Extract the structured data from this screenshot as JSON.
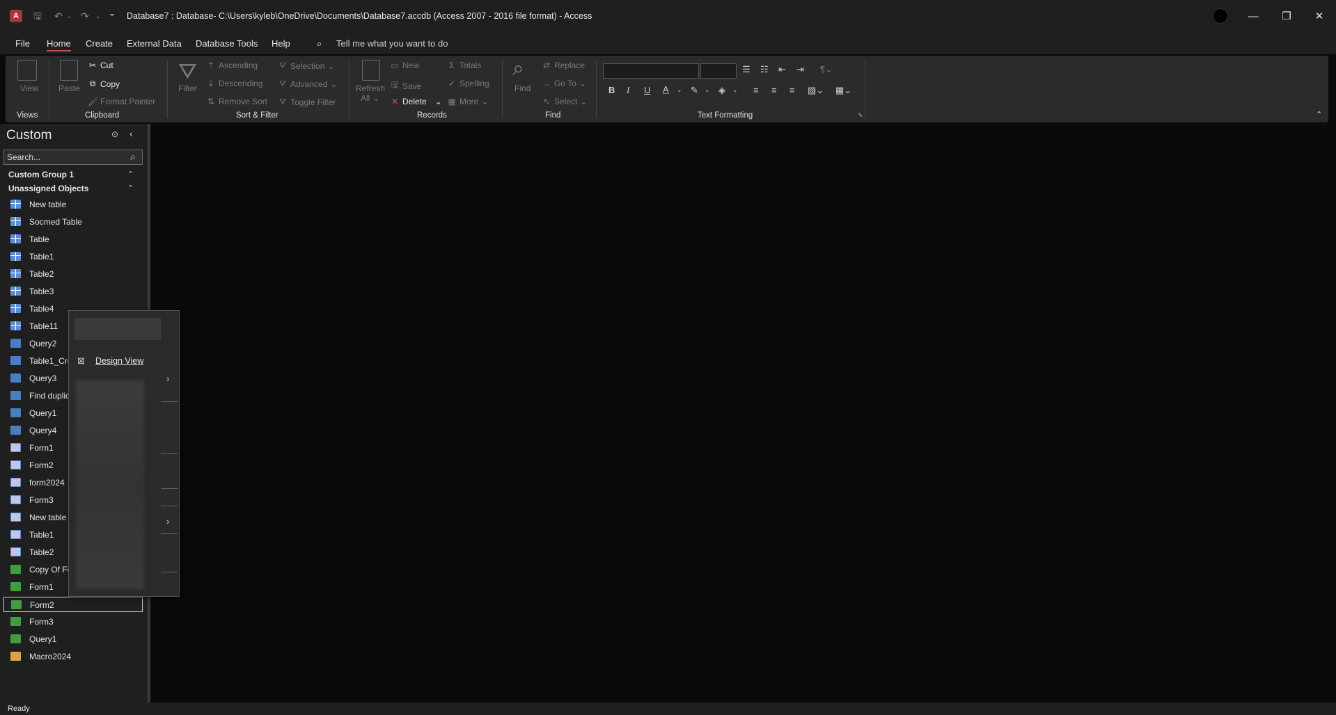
{
  "titlebar": {
    "app_icon": "A",
    "title": "Database7 : Database- C:\\Users\\kyleb\\OneDrive\\Documents\\Database7.accdb (Access 2007 - 2016 file format)  -  Access",
    "minimize": "—",
    "restore": "❐",
    "close": "✕"
  },
  "menu": {
    "tabs": [
      "File",
      "Home",
      "Create",
      "External Data",
      "Database Tools",
      "Help"
    ],
    "tell_me": "Tell me what you want to do"
  },
  "ribbon": {
    "views": {
      "view": "View",
      "label": "Views"
    },
    "clipboard": {
      "paste": "Paste",
      "cut": "Cut",
      "copy": "Copy",
      "format_painter": "Format Painter",
      "label": "Clipboard"
    },
    "sort_filter": {
      "filter": "Filter",
      "ascending": "Ascending",
      "descending": "Descending",
      "remove_sort": "Remove Sort",
      "selection": "Selection",
      "advanced": "Advanced",
      "toggle_filter": "Toggle Filter",
      "label": "Sort & Filter"
    },
    "records": {
      "refresh": "Refresh",
      "refresh_all": "All",
      "new": "New",
      "save": "Save",
      "delete": "Delete",
      "totals": "Totals",
      "spelling": "Spelling",
      "more": "More",
      "label": "Records"
    },
    "find": {
      "find": "Find",
      "replace": "Replace",
      "go_to": "Go To",
      "select": "Select",
      "label": "Find"
    },
    "text_formatting": {
      "bold": "B",
      "italic": "I",
      "underline": "U",
      "font_color": "A",
      "label": "Text Formatting"
    }
  },
  "nav": {
    "title": "Custom",
    "search_placeholder": "Search...",
    "groups": [
      "Custom Group 1",
      "Unassigned Objects"
    ],
    "items": [
      {
        "label": "New table",
        "type": "table"
      },
      {
        "label": "Socmed Table",
        "type": "table"
      },
      {
        "label": "Table",
        "type": "table"
      },
      {
        "label": "Table1",
        "type": "table"
      },
      {
        "label": "Table2",
        "type": "table"
      },
      {
        "label": "Table3",
        "type": "table"
      },
      {
        "label": "Table4",
        "type": "table"
      },
      {
        "label": "Table11",
        "type": "table"
      },
      {
        "label": "Query2",
        "type": "query"
      },
      {
        "label": "Table1_Cro",
        "type": "query"
      },
      {
        "label": "Query3",
        "type": "query"
      },
      {
        "label": "Find duplic",
        "type": "query"
      },
      {
        "label": "Query1",
        "type": "query"
      },
      {
        "label": "Query4",
        "type": "query"
      },
      {
        "label": "Form1",
        "type": "form"
      },
      {
        "label": "Form2",
        "type": "form"
      },
      {
        "label": "form2024",
        "type": "form"
      },
      {
        "label": "Form3",
        "type": "form"
      },
      {
        "label": "New table",
        "type": "form"
      },
      {
        "label": "Table1",
        "type": "form"
      },
      {
        "label": "Table2",
        "type": "form"
      },
      {
        "label": "Copy Of Fo",
        "type": "report"
      },
      {
        "label": "Form1",
        "type": "report"
      },
      {
        "label": "Form2",
        "type": "report",
        "selected": true
      },
      {
        "label": "Form3",
        "type": "report"
      },
      {
        "label": "Query1",
        "type": "report"
      },
      {
        "label": "Macro2024",
        "type": "macro"
      }
    ]
  },
  "context_menu": {
    "design_view": "Design View"
  },
  "status": {
    "text": "Ready"
  }
}
